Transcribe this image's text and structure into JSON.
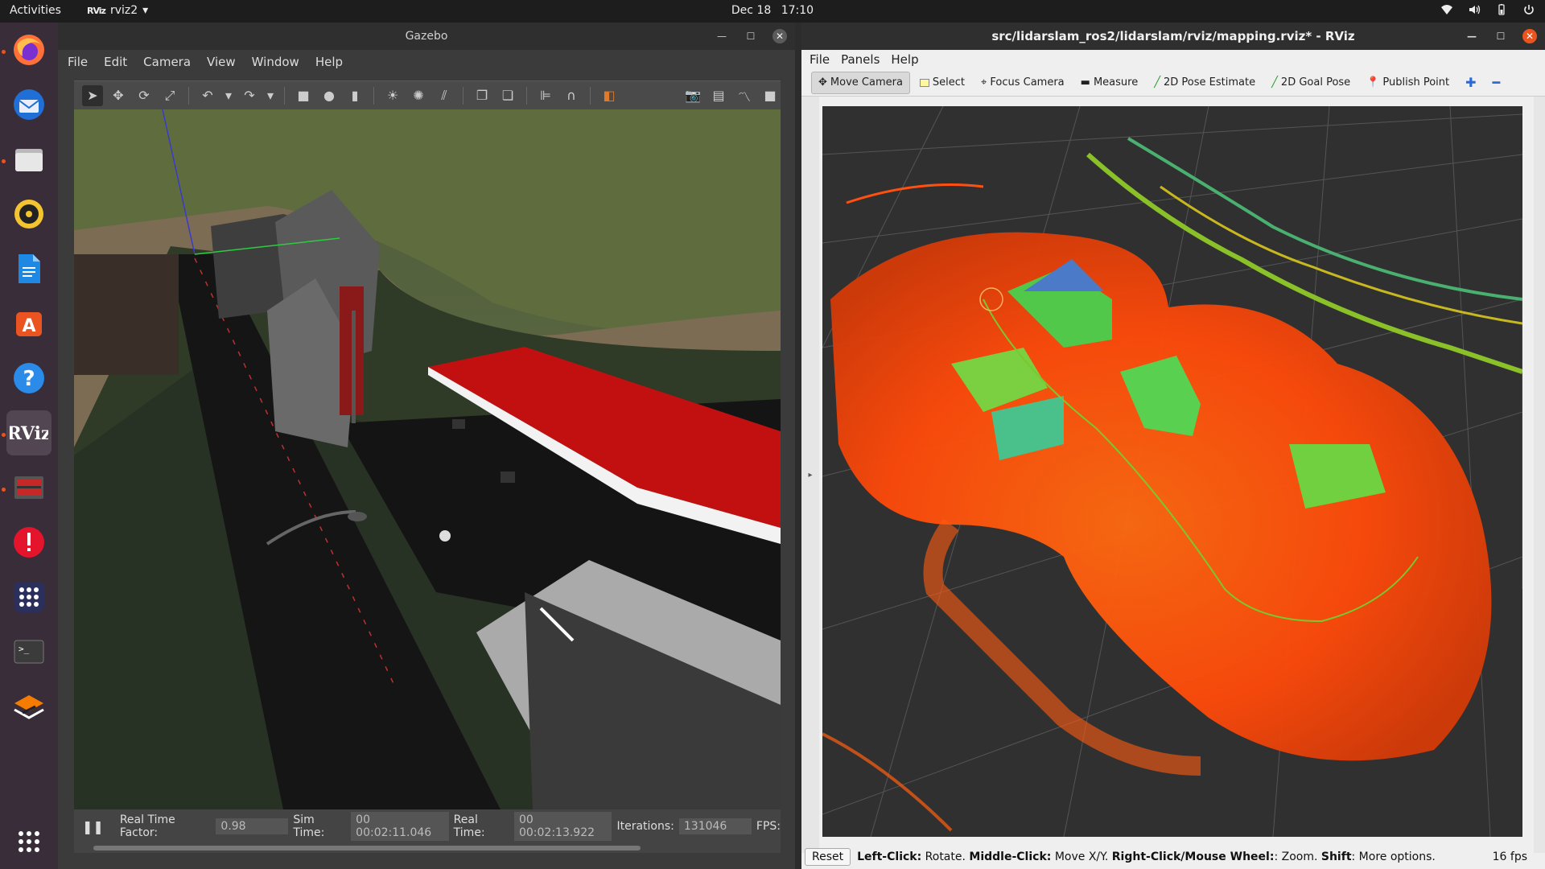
{
  "topbar": {
    "activities": "Activities",
    "app_name": "rviz2",
    "app_icon_text": "RViz",
    "date": "Dec 18",
    "time": "17:10",
    "tray_icons": [
      "wifi-icon",
      "volume-icon",
      "battery-icon",
      "power-icon"
    ]
  },
  "dock": {
    "items": [
      "firefox-icon",
      "thunderbird-icon",
      "files-icon",
      "rhythmbox-icon",
      "writer-icon",
      "software-icon",
      "help-icon",
      "rviz-icon",
      "gazebo-icon",
      "update-icon",
      "apps-grid-icon",
      "terminal-icon",
      "stack-icon"
    ],
    "show_apps": "show-applications-icon",
    "rviz_text": "RViz"
  },
  "gazebo": {
    "title": "Gazebo",
    "menu": [
      "File",
      "Edit",
      "Camera",
      "View",
      "Window",
      "Help"
    ],
    "status": {
      "rtf_label": "Real Time Factor:",
      "rtf_value": "0.98",
      "sim_label": "Sim Time:",
      "sim_value": "00 00:02:11.046",
      "real_label": "Real Time:",
      "real_value": "00 00:02:13.922",
      "iter_label": "Iterations:",
      "iter_value": "131046",
      "fps_label": "FPS:"
    }
  },
  "rviz": {
    "title": "src/lidarslam_ros2/lidarslam/rviz/mapping.rviz* - RViz",
    "menu": [
      "File",
      "Panels",
      "Help"
    ],
    "tools": [
      "Move Camera",
      "Select",
      "Focus Camera",
      "Measure",
      "2D Pose Estimate",
      "2D Goal Pose",
      "Publish Point"
    ],
    "status": {
      "reset": "Reset",
      "left_click": "Left-Click:",
      "left_desc": "Rotate.",
      "middle_click": "Middle-Click:",
      "middle_desc": "Move X/Y.",
      "right_click": "Right-Click/Mouse Wheel:",
      "right_desc": ": Zoom.",
      "shift": "Shift",
      "shift_desc": ": More options.",
      "fps": "16 fps"
    }
  }
}
